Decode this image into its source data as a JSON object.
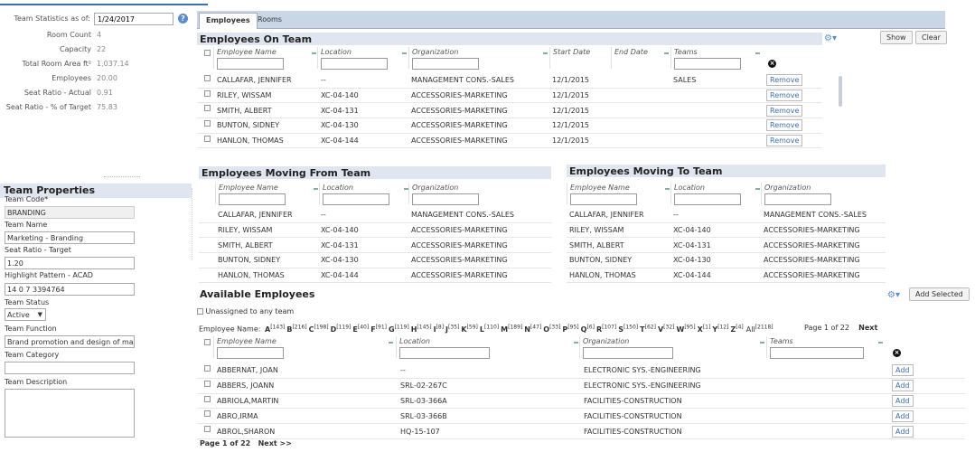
{
  "stats": {
    "as_of_label": "Team Statistics as of:",
    "as_of_value": "1/24/2017",
    "items": [
      {
        "label": "Room Count",
        "value": "4"
      },
      {
        "label": "Capacity",
        "value": "22"
      },
      {
        "label": "Total Room Area ft²",
        "value": "1,037.14"
      },
      {
        "label": "Employees",
        "value": "20.00"
      },
      {
        "label": "Seat Ratio - Actual",
        "value": "0.91"
      },
      {
        "label": "Seat Ratio - % of Target",
        "value": "75.83"
      }
    ]
  },
  "team_properties": {
    "title": "Team Properties",
    "team_code_label": "Team Code*",
    "team_code_value": "BRANDING",
    "team_name_label": "Team Name",
    "team_name_value": "Marketing - Branding",
    "seat_ratio_label": "Seat Ratio - Target",
    "seat_ratio_value": "1.20",
    "highlight_label": "Highlight Pattern - ACAD",
    "highlight_value": "14 0 7 3394764",
    "status_label": "Team Status",
    "status_value": "Active",
    "function_label": "Team Function",
    "function_value": "Brand promotion and design of marke",
    "category_label": "Team Category",
    "category_value": "",
    "description_label": "Team Description"
  },
  "tabs": [
    {
      "label": "Employees"
    },
    {
      "label": "Rooms"
    }
  ],
  "on_team": {
    "title": "Employees On Team",
    "show_label": "Show",
    "clear_label": "Clear",
    "columns": [
      "Employee Name",
      "Location",
      "Organization",
      "Start Date",
      "End Date",
      "Teams"
    ],
    "remove_label": "Remove",
    "rows": [
      {
        "name": "CALLAFAR, JENNIFER",
        "location": "--",
        "org": "MANAGEMENT CONS.-SALES",
        "start": "12/1/2015",
        "end": "",
        "teams": "SALES"
      },
      {
        "name": "RILEY, WISSAM",
        "location": "XC-04-140",
        "org": "ACCESSORIES-MARKETING",
        "start": "12/1/2015",
        "end": "",
        "teams": ""
      },
      {
        "name": "SMITH, ALBERT",
        "location": "XC-04-131",
        "org": "ACCESSORIES-MARKETING",
        "start": "12/1/2015",
        "end": "",
        "teams": ""
      },
      {
        "name": "BUNTON, SIDNEY",
        "location": "XC-04-130",
        "org": "ACCESSORIES-MARKETING",
        "start": "12/1/2015",
        "end": "",
        "teams": ""
      },
      {
        "name": "HANLON, THOMAS",
        "location": "XC-04-144",
        "org": "ACCESSORIES-MARKETING",
        "start": "12/1/2015",
        "end": "",
        "teams": ""
      }
    ]
  },
  "moving_from": {
    "title": "Employees Moving From Team",
    "columns": [
      "Employee Name",
      "Location",
      "Organization"
    ],
    "rows": [
      {
        "name": "CALLAFAR, JENNIFER",
        "location": "--",
        "org": "MANAGEMENT CONS.-SALES"
      },
      {
        "name": "RILEY, WISSAM",
        "location": "XC-04-140",
        "org": "ACCESSORIES-MARKETING"
      },
      {
        "name": "SMITH, ALBERT",
        "location": "XC-04-131",
        "org": "ACCESSORIES-MARKETING"
      },
      {
        "name": "BUNTON, SIDNEY",
        "location": "XC-04-130",
        "org": "ACCESSORIES-MARKETING"
      },
      {
        "name": "HANLON, THOMAS",
        "location": "XC-04-144",
        "org": "ACCESSORIES-MARKETING"
      }
    ]
  },
  "moving_to": {
    "title": "Employees Moving To Team",
    "columns": [
      "Employee Name",
      "Location",
      "Organization"
    ],
    "rows": [
      {
        "name": "CALLAFAR, JENNIFER",
        "location": "--",
        "org": "MANAGEMENT CONS.-SALES"
      },
      {
        "name": "RILEY, WISSAM",
        "location": "XC-04-140",
        "org": "ACCESSORIES-MARKETING"
      },
      {
        "name": "SMITH, ALBERT",
        "location": "XC-04-131",
        "org": "ACCESSORIES-MARKETING"
      },
      {
        "name": "BUNTON, SIDNEY",
        "location": "XC-04-130",
        "org": "ACCESSORIES-MARKETING"
      },
      {
        "name": "HANLON, THOMAS",
        "location": "XC-04-144",
        "org": "ACCESSORIES-MARKETING"
      }
    ]
  },
  "available": {
    "title": "Available Employees",
    "add_selected_label": "Add Selected",
    "unassigned_label": "Unassigned to any team",
    "alpha_label": "Employee Name:",
    "alpha": [
      {
        "l": "A",
        "c": "[143]"
      },
      {
        "l": "B",
        "c": "[216]"
      },
      {
        "l": "C",
        "c": "[198]"
      },
      {
        "l": "D",
        "c": "[119]"
      },
      {
        "l": "E",
        "c": "[40]"
      },
      {
        "l": "F",
        "c": "[91]"
      },
      {
        "l": "G",
        "c": "[119]"
      },
      {
        "l": "H",
        "c": "[145]"
      },
      {
        "l": "I",
        "c": "[8]"
      },
      {
        "l": "J",
        "c": "[35]"
      },
      {
        "l": "K",
        "c": "[59]"
      },
      {
        "l": "L",
        "c": "[110]"
      },
      {
        "l": "M",
        "c": "[189]"
      },
      {
        "l": "N",
        "c": "[47]"
      },
      {
        "l": "O",
        "c": "[33]"
      },
      {
        "l": "P",
        "c": "[95]"
      },
      {
        "l": "Q",
        "c": "[6]"
      },
      {
        "l": "R",
        "c": "[107]"
      },
      {
        "l": "S",
        "c": "[150]"
      },
      {
        "l": "T",
        "c": "[62]"
      },
      {
        "l": "V",
        "c": "[32]"
      },
      {
        "l": "W",
        "c": "[95]"
      },
      {
        "l": "X",
        "c": "[1]"
      },
      {
        "l": "Y",
        "c": "[12]"
      },
      {
        "l": "Z",
        "c": "[4]"
      }
    ],
    "all_label": "All",
    "all_count": "[2118]",
    "page_info": "Page 1 of 22",
    "next_label": "Next",
    "columns": [
      "Employee Name",
      "Location",
      "Organization",
      "Teams"
    ],
    "add_label": "Add",
    "rows": [
      {
        "name": "ABBERNAT, JOAN",
        "location": "--",
        "org": "ELECTRONIC SYS.-ENGINEERING"
      },
      {
        "name": "ABBERS, JOANN",
        "location": "SRL-02-267C",
        "org": "ELECTRONIC SYS.-ENGINEERING"
      },
      {
        "name": "ABRIOLA,MARTIN",
        "location": "SRL-03-366A",
        "org": "FACILITIES-CONSTRUCTION"
      },
      {
        "name": "ABRO,IRMA",
        "location": "SRL-03-366B",
        "org": "FACILITIES-CONSTRUCTION"
      },
      {
        "name": "ABROL,SHARON",
        "location": "HQ-15-107",
        "org": "FACILITIES-CONSTRUCTION"
      }
    ],
    "bottom_page": "Page 1 of 22",
    "bottom_next": "Next >>"
  }
}
